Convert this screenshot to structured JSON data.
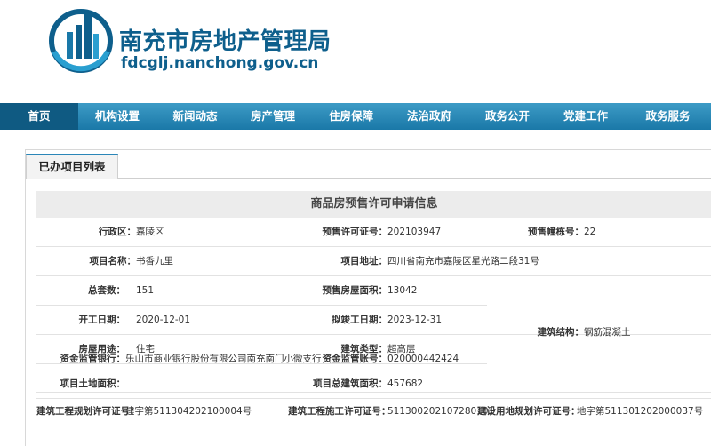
{
  "site": {
    "title": "南充市房地产管理局",
    "url": "fdcglj.nanchong.gov.cn"
  },
  "nav": [
    "首页",
    "机构设置",
    "新闻动态",
    "房产管理",
    "住房保障",
    "法治政府",
    "政务公开",
    "党建工作",
    "政务服务"
  ],
  "tab": "已办项目列表",
  "info_title": "商品房预售许可申请信息",
  "fields": {
    "district_label": "行政区：",
    "district": "嘉陵区",
    "permit_no_label": "预售许可证号：",
    "permit_no": "202103947",
    "bldg_count_label": "预售幢栋号：",
    "bldg_count": "22",
    "project_label": "项目名称：",
    "project": "书香九里",
    "address_label": "项目地址：",
    "address": "四川省南充市嘉陵区星光路二段31号",
    "units_label": "总套数：",
    "units": "151",
    "presale_area_label": "预售房屋面积：",
    "presale_area": "13042",
    "start_label": "开工日期：",
    "start": "2020-12-01",
    "end_label": "拟竣工日期：",
    "end": "2023-12-31",
    "usage_label": "房屋用途：",
    "usage": "住宅",
    "type_label": "建筑类型：",
    "type": "超高层",
    "structure_label": "建筑结构：",
    "structure": "钢筋混凝土",
    "bank_label": "资金监管银行：",
    "bank": "乐山市商业银行股份有限公司南充南门小微支行",
    "account_label": "资金监管账号：",
    "account": "020000442424",
    "land_area_label": "项目土地面积：",
    "land_area": "",
    "total_area_label": "项目总建筑面积：",
    "total_area": "457682",
    "plan_permit_label": "建筑工程规划许可证号：",
    "plan_permit": "建字第511304202100004号",
    "construct_permit_label": "建筑工程施工许可证号：",
    "construct_permit": "511300202107280101",
    "land_permit_label": "建设用地规划许可证号：",
    "land_permit": "地字第511301202000037号"
  },
  "colors": {
    "nav_top": "#3d9bc6",
    "nav_bottom": "#1a78a8",
    "nav_active": "#0f5a82",
    "brand": "#0e5f8c"
  }
}
